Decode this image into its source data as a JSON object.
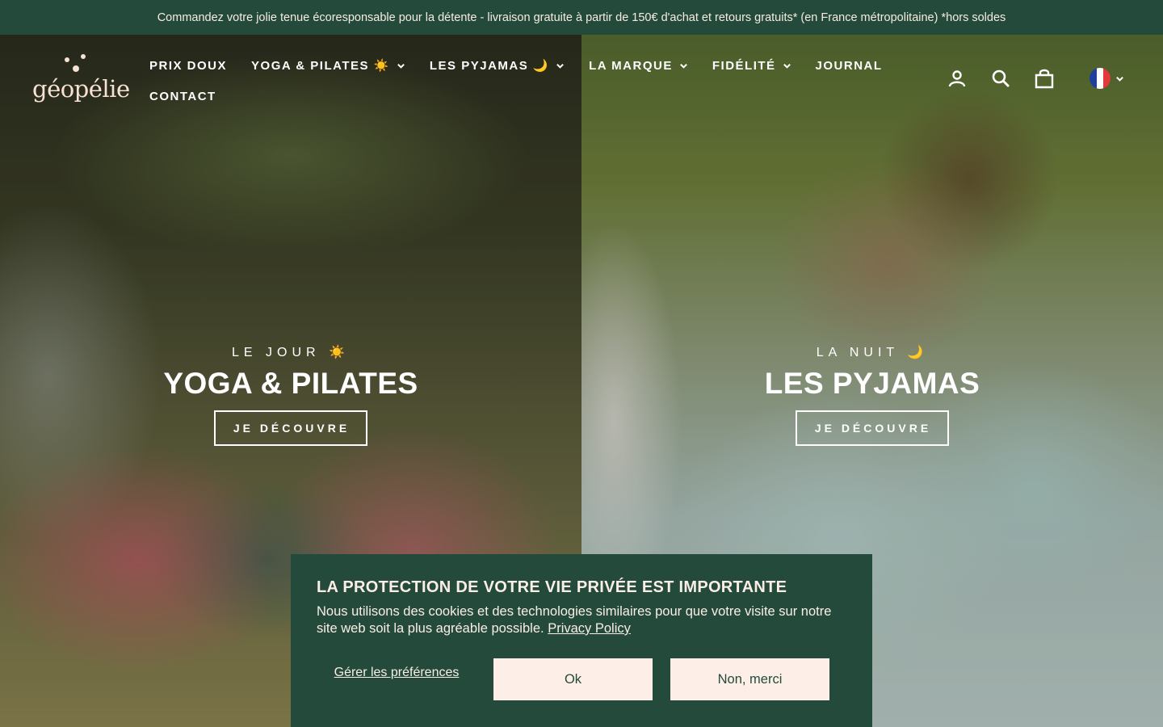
{
  "announcement": "Commandez votre jolie tenue écoresponsable pour la détente - livraison gratuite à partir de 150€ d'achat et retours gratuits* (en France métropolitaine) *hors soldes",
  "brand": {
    "logo_text": "géopélie"
  },
  "nav": {
    "items": [
      {
        "label": "PRIX DOUX"
      },
      {
        "label": "YOGA & PILATES ☀️"
      },
      {
        "label": "LES PYJAMAS 🌙"
      },
      {
        "label": "LA MARQUE"
      },
      {
        "label": "FIDÉLITÉ"
      },
      {
        "label": "JOURNAL"
      },
      {
        "label": "CONTACT"
      }
    ]
  },
  "header_icons": [
    "account-icon",
    "search-icon",
    "cart-icon",
    "france-flag-icon",
    "chevron-down-icon"
  ],
  "hero": {
    "day": {
      "kicker": "LE JOUR ☀️",
      "title": "YOGA & PILATES",
      "button": "JE DÉCOUVRE"
    },
    "night": {
      "kicker": "LA NUIT 🌙",
      "title": "LES PYJAMAS",
      "button": "JE DÉCOUVRE"
    }
  },
  "cookie": {
    "title": "LA PROTECTION DE VOTRE VIE PRIVÉE EST IMPORTANTE",
    "text": "Nous utilisons des cookies et des technologies similaires pour que votre visite sur notre site web soit la plus agréable possible.",
    "link": "Privacy Policy",
    "manage": "Gérer les préférences",
    "ok": "Ok",
    "decline": "Non, merci"
  },
  "colors": {
    "brand_green": "#234a3a",
    "cream": "#fdefe8",
    "logo_pink": "#f6e1d2"
  }
}
